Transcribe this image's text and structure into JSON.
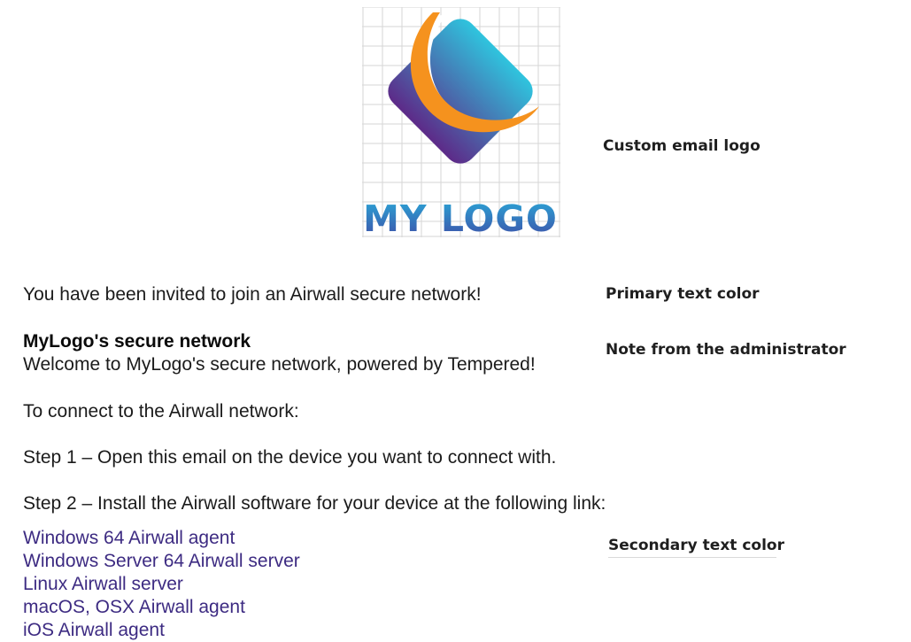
{
  "logo": {
    "text": "MY LOGO",
    "colors": {
      "gradient_top": "#2fc4de",
      "gradient_bottom": "#5d2a88",
      "arc": "#f5921e",
      "text_top": "#2aa8d8",
      "text_bottom": "#3e4fa8"
    }
  },
  "annotations": {
    "logo_label": "Custom email logo",
    "primary_label": "Primary text color",
    "note_label": "Note from the administrator",
    "secondary_label": "Secondary text color"
  },
  "email": {
    "invite": "You have been invited to join an Airwall secure network!",
    "network_title": "MyLogo's secure network",
    "welcome": "Welcome to MyLogo's secure network, powered by Tempered!",
    "connect_intro": "To connect to the Airwall network:",
    "step1": "Step 1 – Open this email on the device you want to connect with.",
    "step2": "Step 2 – Install the Airwall software for your device at the following link:",
    "links": [
      "Windows 64 Airwall agent",
      "Windows Server 64 Airwall server",
      "Linux Airwall server",
      "macOS, OSX Airwall agent",
      "iOS Airwall agent"
    ]
  },
  "colors": {
    "primary_text": "#1b1b1b",
    "secondary_text": "#3d2b82"
  }
}
